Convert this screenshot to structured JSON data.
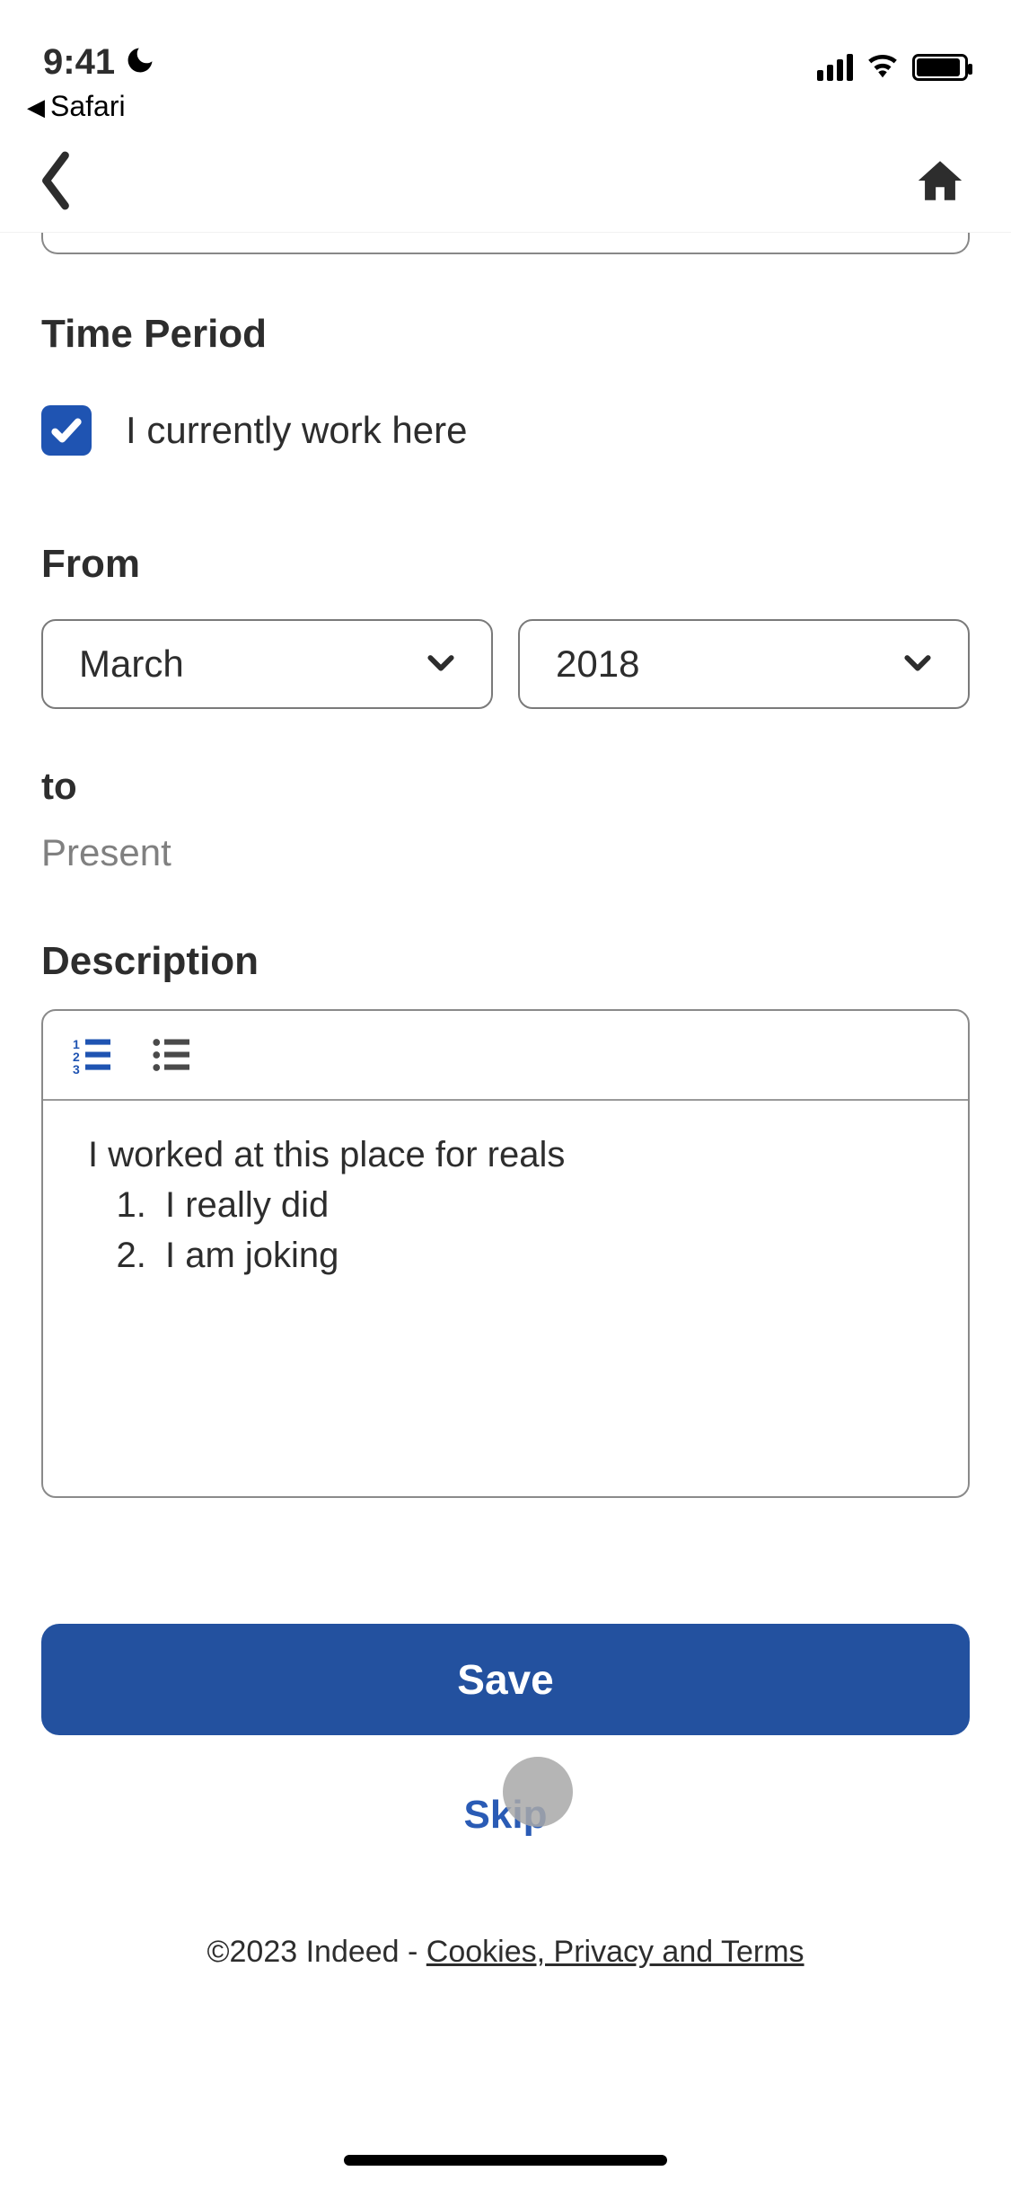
{
  "status_bar": {
    "time": "9:41",
    "back_app": "Safari"
  },
  "sections": {
    "time_period": {
      "label": "Time Period"
    },
    "currently_work": {
      "label": "I currently work here",
      "checked": true
    },
    "from": {
      "label": "From",
      "month": "March",
      "year": "2018"
    },
    "to": {
      "label": "to",
      "value": "Present"
    },
    "description": {
      "label": "Description",
      "intro": "I worked at this place for reals",
      "list": [
        "I really did",
        "I am joking"
      ]
    }
  },
  "actions": {
    "save": "Save",
    "skip": "Skip"
  },
  "footer": {
    "copyright": "©2023 Indeed - ",
    "link": "Cookies, Privacy and Terms"
  }
}
